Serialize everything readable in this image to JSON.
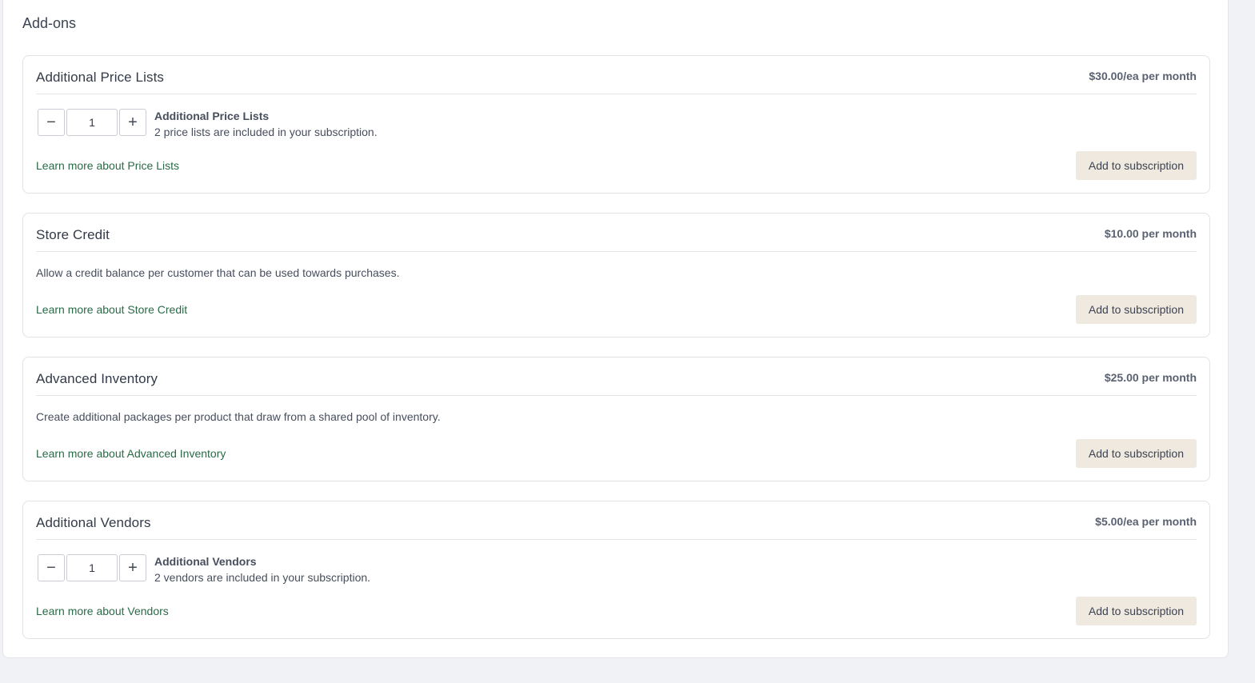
{
  "section_title": "Add-ons",
  "addons": [
    {
      "title": "Additional Price Lists",
      "price": "$30.00/ea per month",
      "quantity": "1",
      "qty_title": "Additional Price Lists",
      "qty_subtitle": "2 price lists are included in your subscription.",
      "learn_more": "Learn more about Price Lists",
      "button": "Add to subscription"
    },
    {
      "title": "Store Credit",
      "price": "$10.00 per month",
      "description": "Allow a credit balance per customer that can be used towards purchases.",
      "learn_more": "Learn more about Store Credit",
      "button": "Add to subscription"
    },
    {
      "title": "Advanced Inventory",
      "price": "$25.00 per month",
      "description": "Create additional packages per product that draw from a shared pool of inventory.",
      "learn_more": "Learn more about Advanced Inventory",
      "button": "Add to subscription"
    },
    {
      "title": "Additional Vendors",
      "price": "$5.00/ea per month",
      "quantity": "1",
      "qty_title": "Additional Vendors",
      "qty_subtitle": "2 vendors are included in your subscription.",
      "learn_more": "Learn more about Vendors",
      "button": "Add to subscription"
    }
  ],
  "icons": {
    "minus": "minus-icon",
    "plus": "plus-icon"
  },
  "colors": {
    "link": "#2b6a47",
    "button_bg": "#f0e9df",
    "page_bg": "#f1f2f5"
  }
}
